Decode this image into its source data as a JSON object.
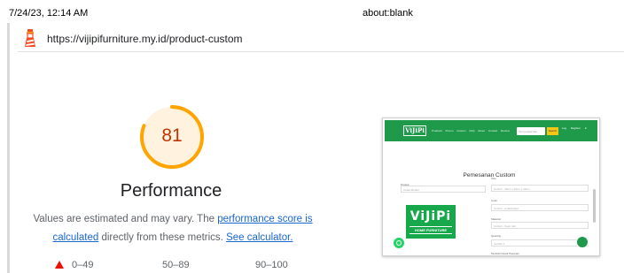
{
  "print_header": {
    "date": "7/24/23, 12:14 AM",
    "page_title": "about:blank"
  },
  "url": "https://vijipifurniture.my.id/product-custom",
  "category": {
    "score": "81",
    "score_fraction": 0.81,
    "title": "Performance",
    "description": {
      "prefix": "Values are estimated and may vary. The ",
      "link1": "performance score is calculated",
      "middle": " directly from these metrics. ",
      "link2": "See calculator."
    }
  },
  "legend": {
    "fail": "0–49",
    "average": "50–89",
    "pass": "90–100"
  },
  "colors": {
    "average": "#ffa400",
    "average_text": "#c33300",
    "fail": "#eb0f00",
    "link": "#1967d2",
    "brand_green": "#1f9a4a"
  },
  "screenshot": {
    "logo": "ViJiPi",
    "menu": "Products Promo Custom FAQ About Contact Review",
    "search_placeholder": "Cari produk lain",
    "search_button": "Search",
    "auth": "Log Register in",
    "heading": "Pemesanan Custom",
    "product_label": "Produk",
    "product_value": "Cetak Medial",
    "size_label": "Size",
    "size_value": "Contoh : 30cm x 20cm x 40cm",
    "color_label": "Color",
    "color_value": "Contoh : Coklat Kayu",
    "material_label": "Material",
    "material_value": "Contoh : Kayu Jati",
    "qty_label": "Quantity",
    "qty_value": "Jumlah 1",
    "note_label": "Tambah Detail Pesanan",
    "banner_main": "ViJiPi",
    "banner_sub": "HOME FURNITURE"
  }
}
